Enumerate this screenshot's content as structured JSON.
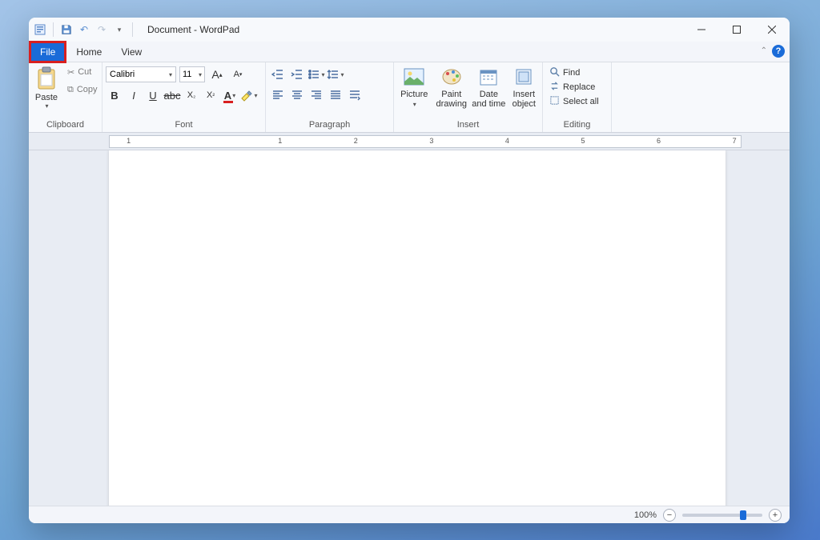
{
  "title": "Document - WordPad",
  "tabs": {
    "file": "File",
    "home": "Home",
    "view": "View"
  },
  "clipboard": {
    "paste": "Paste",
    "cut": "Cut",
    "copy": "Copy",
    "group": "Clipboard"
  },
  "font": {
    "family": "Calibri",
    "size": "11",
    "grow": "A",
    "shrink": "A",
    "group": "Font"
  },
  "paragraph": {
    "group": "Paragraph"
  },
  "insert": {
    "picture": "Picture",
    "paint": "Paint drawing",
    "date": "Date and time",
    "object": "Insert object",
    "group": "Insert"
  },
  "editing": {
    "find": "Find",
    "replace": "Replace",
    "select_all": "Select all",
    "group": "Editing"
  },
  "ruler_numbers": [
    "1",
    "1",
    "2",
    "3",
    "4",
    "5",
    "6",
    "7"
  ],
  "status": {
    "zoom": "100%"
  }
}
